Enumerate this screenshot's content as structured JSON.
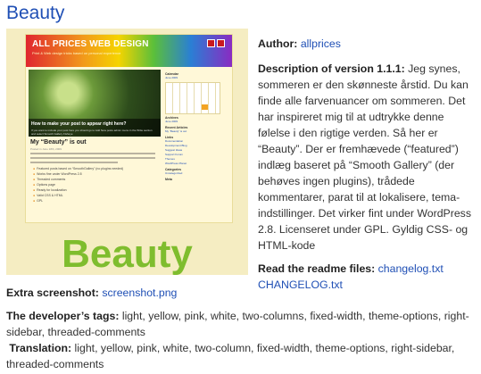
{
  "title": "Beauty",
  "thumbnail": {
    "site_title": "ALL PRICES WEB DESIGN",
    "tagline": "Print & Web design tricks based on personal experience",
    "gallery_title": "How to make your post to appear right here?",
    "gallery_text": "If you want to include your post here you should go to Add New posts admin menu in the Write section and select Smooth Gallery Fisheye",
    "post_title": "My “Beauty” is out",
    "post_meta": "Posted in June 18th, 2009",
    "bullets": [
      "Featured posts based on “SmoothGallery” (no plugins needed)",
      "Works fine under WordPress 2.8",
      "Threaded comments",
      "Options page",
      "Ready for localization",
      "Valid CSS & HTML",
      "GPL"
    ],
    "sidebar_headings": [
      "Calendar",
      "Archives",
      "Recent Articles",
      "Links",
      "Categories",
      "Meta"
    ],
    "sidebar_links": [
      "June 2009",
      "My “Beauty” is out",
      "Documentation",
      "Development Blog",
      "Suggest Ideas",
      "Support Forum",
      "Themes",
      "WordPress Planet",
      "Uncategorized"
    ],
    "big_word": "Beauty"
  },
  "author": {
    "label": "Author:",
    "value": "allprices"
  },
  "description": {
    "label": "Description of version 1.1.1:",
    "text": " Jeg synes, sommeren er den skønneste årstid. Du kan finde alle farvenuancer om sommeren. Det har inspireret mig til at udtrykke denne følelse i den rigtige verden. Så her er “Beauty”. Der er fremhævede (“featured”) indlæg baseret på “Smooth Gallery” (der behøves ingen plugins), trådede kommentarer, parat til at lokalisere, tema-indstillinger. Det virker fint under WordPress 2.8. Licenseret under GPL. Gyldig CSS- og HTML-kode"
  },
  "readme": {
    "label": "Read the readme files:",
    "link1": "changelog.txt",
    "link2": "CHANGELOG.txt"
  },
  "extra_screenshot": {
    "label": "Extra screenshot:",
    "link": "screenshot.png"
  },
  "developer_tags": {
    "label": "The developer’s tags:",
    "value": " light, yellow, pink, white, two-columns, fixed-width, theme-options, right-sidebar, threaded-comments"
  },
  "translation": {
    "label": "Translation:",
    "value": " light, yellow, pink, white, two-column, fixed-width, theme-options, right-sidebar, threaded-comments"
  },
  "colors": {
    "link": "#1f4fb5",
    "thumb_bg": "#f5edc2",
    "beauty_green": "#7fbd2e"
  }
}
